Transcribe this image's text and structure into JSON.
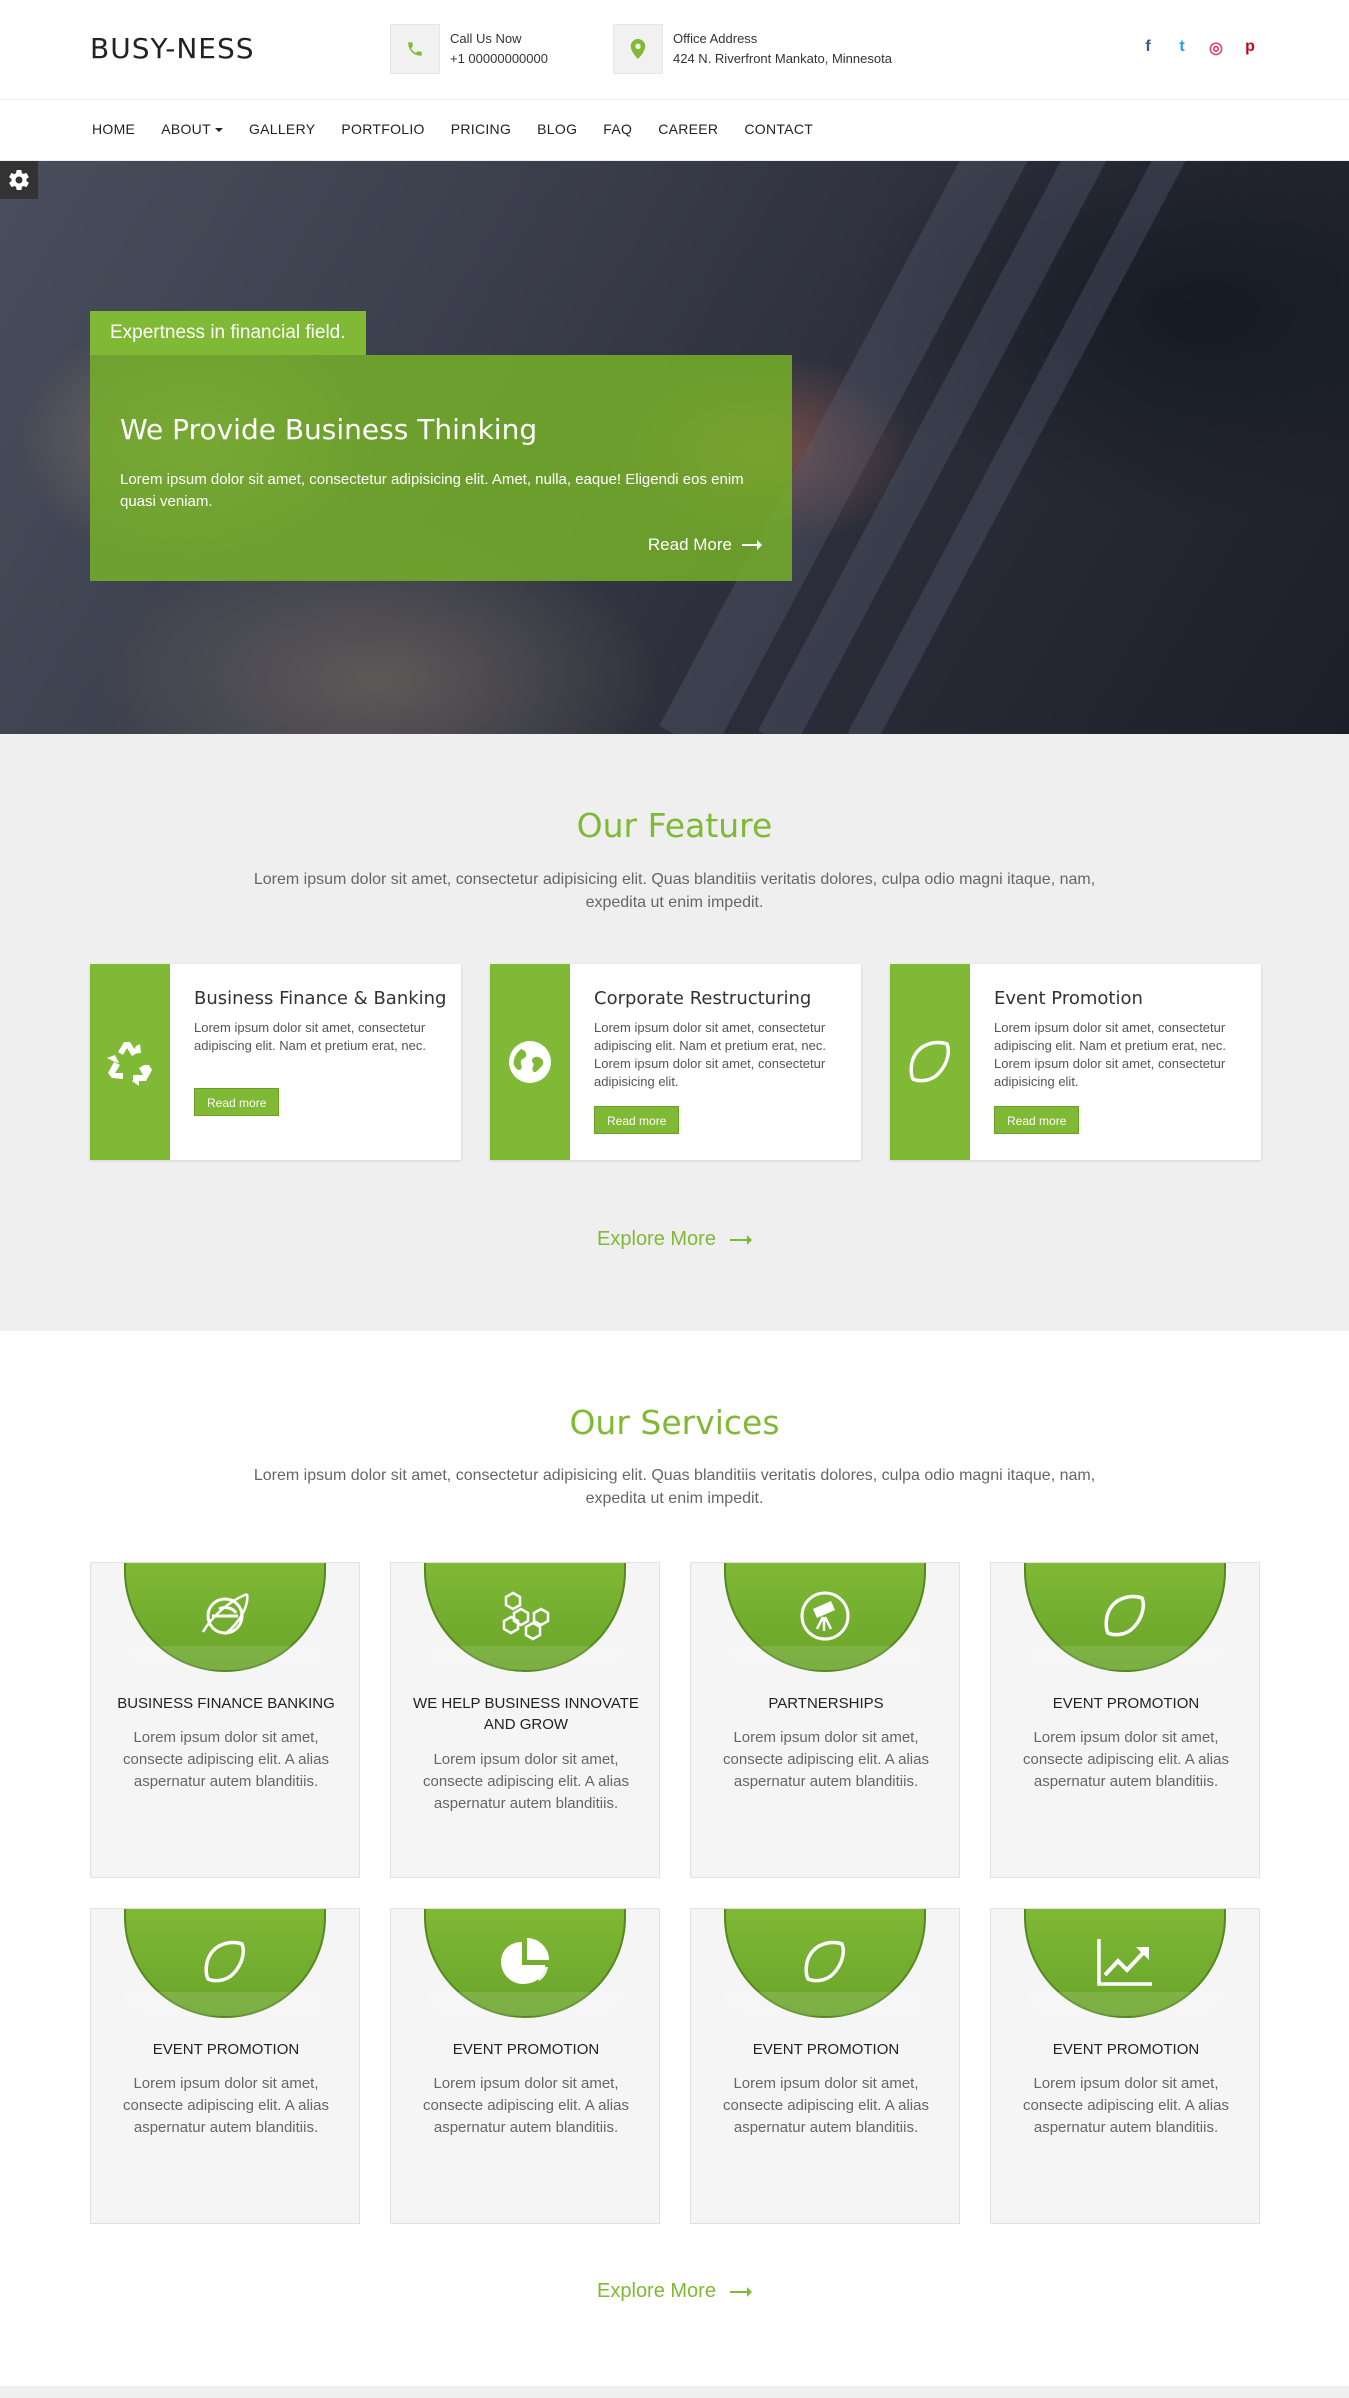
{
  "header": {
    "logo": "BUSY-NESS",
    "call": {
      "label": "Call Us Now",
      "value": "+1 00000000000"
    },
    "address": {
      "label": "Office Address",
      "value": "424 N. Riverfront Mankato, Minnesota"
    },
    "socials": [
      {
        "name": "facebook",
        "glyph": "f",
        "color": "#3b5998"
      },
      {
        "name": "twitter",
        "glyph": "t",
        "color": "#1da1f2"
      },
      {
        "name": "instagram",
        "glyph": "◎",
        "color": "#e4405f"
      },
      {
        "name": "pinterest",
        "glyph": "p",
        "color": "#bd081c"
      }
    ]
  },
  "nav": {
    "items": [
      "HOME",
      "ABOUT",
      "GALLERY",
      "PORTFOLIO",
      "PRICING",
      "BLOG",
      "FAQ",
      "CAREER",
      "CONTACT"
    ]
  },
  "hero": {
    "tag": "Expertness in financial field.",
    "title": "We Provide Business Thinking",
    "text": "Lorem ipsum dolor sit amet, consectetur adipisicing elit. Amet, nulla, eaque! Eligendi eos enim quasi veniam.",
    "read_more": "Read More"
  },
  "features": {
    "title": "Our Feature",
    "subtitle": "Lorem ipsum dolor sit amet, consectetur adipisicing elit. Quas blanditiis veritatis dolores, culpa odio magni itaque, nam, expedita ut enim impedit.",
    "cards": [
      {
        "icon": "recycle-icon",
        "title": "Business Finance & Banking",
        "text": "Lorem ipsum dolor sit amet, consectetur adipiscing elit. Nam et pretium erat, nec.",
        "button": "Read more"
      },
      {
        "icon": "globe-icon",
        "title": "Corporate Restructuring",
        "text": "Lorem ipsum dolor sit amet, consectetur adipiscing elit. Nam et pretium erat, nec. Lorem ipsum dolor sit amet, consectetur adipisicing elit.",
        "button": "Read more"
      },
      {
        "icon": "lemon-icon",
        "title": "Event Promotion",
        "text": "Lorem ipsum dolor sit amet, consectetur adipiscing elit. Nam et pretium erat, nec. Lorem ipsum dolor sit amet, consectetur adipisicing elit.",
        "button": "Read more"
      }
    ],
    "explore": "Explore More"
  },
  "services": {
    "title": "Our Services",
    "subtitle": "Lorem ipsum dolor sit amet, consectetur adipisicing elit. Quas blanditiis veritatis dolores, culpa odio magni itaque, nam, expedita ut enim impedit.",
    "cards": [
      {
        "icon": "internet-explorer-icon",
        "title": "BUSINESS FINANCE   BANKING",
        "text": "Lorem ipsum dolor sit amet, consecte adipiscing elit. A alias aspernatur autem blanditiis."
      },
      {
        "icon": "cubes-icon",
        "title": "WE HELP BUSINESS INNOVATE AND GROW",
        "text": "Lorem ipsum dolor sit amet, consecte adipiscing elit. A alias aspernatur autem blanditiis."
      },
      {
        "icon": "telescope-icon",
        "title": "PARTNERSHIPS",
        "text": "Lorem ipsum dolor sit amet, consecte adipiscing elit. A alias aspernatur autem blanditiis."
      },
      {
        "icon": "lemon-icon",
        "title": "EVENT PROMOTION",
        "text": "Lorem ipsum dolor sit amet, consecte adipiscing elit. A alias aspernatur autem blanditiis."
      },
      {
        "icon": "lemon-icon",
        "title": "EVENT PROMOTION",
        "text": "Lorem ipsum dolor sit amet, consecte adipiscing elit. A alias aspernatur autem blanditiis."
      },
      {
        "icon": "pie-chart-icon",
        "title": "EVENT PROMOTION",
        "text": "Lorem ipsum dolor sit amet, consecte adipiscing elit. A alias aspernatur autem blanditiis."
      },
      {
        "icon": "lemon-icon",
        "title": "EVENT PROMOTION",
        "text": "Lorem ipsum dolor sit amet, consecte adipiscing elit. A alias aspernatur autem blanditiis."
      },
      {
        "icon": "line-chart-icon",
        "title": "EVENT PROMOTION",
        "text": "Lorem ipsum dolor sit amet, consecte adipiscing elit. A alias aspernatur autem blanditiis."
      }
    ],
    "explore": "Explore More"
  },
  "colors": {
    "accent": "#7fb935",
    "dark": "#222222",
    "section_bg": "#efefef"
  }
}
